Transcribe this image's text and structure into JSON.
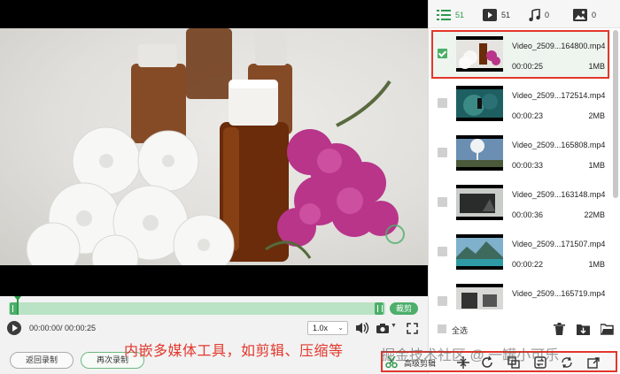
{
  "player": {
    "time_display": "00:00:00/ 00:00:25",
    "speed": "1.0x",
    "cut_label": "裁剪"
  },
  "buttons": {
    "back_record": "返回录制",
    "record_again": "再次录制"
  },
  "overlay": {
    "caption": "内嵌多媒体工具，如剪辑、压缩等",
    "watermark": "掘金技术社区 @ 一罐小可乐"
  },
  "tabs": [
    {
      "label": "51",
      "icon": "list-icon"
    },
    {
      "label": "51",
      "icon": "video-icon"
    },
    {
      "label": "0",
      "icon": "music-icon"
    },
    {
      "label": "0",
      "icon": "image-icon"
    }
  ],
  "files": [
    {
      "name": "Video_2509...164800.mp4",
      "duration": "00:00:25",
      "size": "1MB",
      "selected": true
    },
    {
      "name": "Video_2509...172514.mp4",
      "duration": "00:00:23",
      "size": "2MB",
      "selected": false
    },
    {
      "name": "Video_2509...165808.mp4",
      "duration": "00:00:33",
      "size": "1MB",
      "selected": false
    },
    {
      "name": "Video_2509...163148.mp4",
      "duration": "00:00:36",
      "size": "22MB",
      "selected": false
    },
    {
      "name": "Video_2509...171507.mp4",
      "duration": "00:00:22",
      "size": "1MB",
      "selected": false
    },
    {
      "name": "Video_2509...165719.mp4",
      "duration": "",
      "size": "",
      "selected": false
    }
  ],
  "sidebar_footer": {
    "select_all": "全选"
  },
  "tools": {
    "label": "高级剪辑"
  },
  "colors": {
    "accent": "#4caf6a",
    "highlight": "#e3362b"
  }
}
